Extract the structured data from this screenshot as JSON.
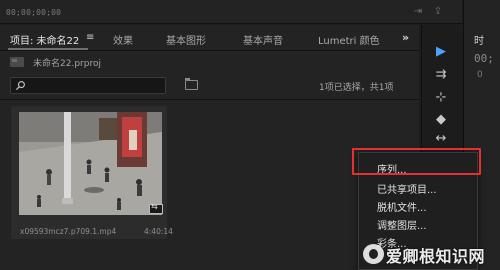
{
  "timeline_bar": {
    "timecode": "00;00;00;00"
  },
  "project_panel": {
    "tabs": [
      {
        "label": "项目: 未命名22",
        "active": true
      },
      {
        "label": "效果"
      },
      {
        "label": "基本图形"
      },
      {
        "label": "基本声音"
      },
      {
        "label": "Lumetri 颜色"
      }
    ],
    "tab_menu_glyph": "≡",
    "overflow_glyph": "»",
    "project_file": "未命名22.prproj",
    "search": {
      "value": "",
      "placeholder": ""
    },
    "selection_status": "1项已选择，共1项",
    "clip": {
      "name": "x09593mcz7.p709.1.mp4",
      "duration": "4:40:14"
    }
  },
  "tools": [
    {
      "name": "selection-tool",
      "icon": "▶",
      "selected": true
    },
    {
      "name": "track-select-tool",
      "icon": "⇉"
    },
    {
      "name": "ripple-edit-tool",
      "icon": "⊹"
    },
    {
      "name": "razor-tool",
      "icon": "◆"
    },
    {
      "name": "slip-tool",
      "icon": "↔"
    },
    {
      "name": "pen-tool",
      "icon": "✒"
    }
  ],
  "right_panel": {
    "tab_label": "时",
    "timecode": "00;",
    "sub": "0"
  },
  "context_menu": {
    "items": [
      "序列...",
      "已共享项目...",
      "脱机文件...",
      "调整图层...",
      "彩条..."
    ]
  },
  "watermark": {
    "text": "爱卿根知识网"
  },
  "colors": {
    "accent": "#4aa3ff",
    "highlight": "#e63030",
    "bg": "#232323"
  }
}
